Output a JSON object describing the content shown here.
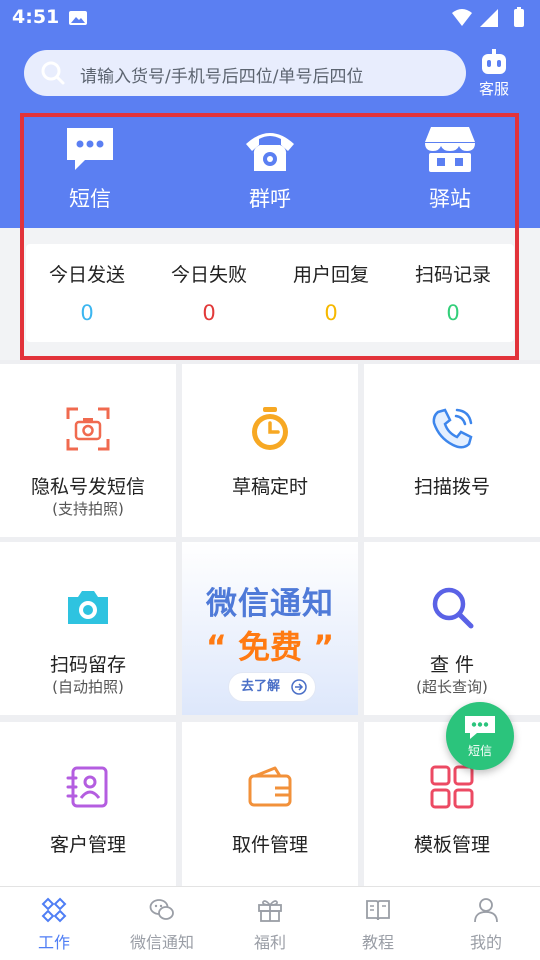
{
  "status_bar": {
    "time": "4:51"
  },
  "search": {
    "placeholder": "请输入货号/手机号后四位/单号后四位"
  },
  "customer_service": {
    "label": "客服"
  },
  "quick_actions": [
    {
      "label": "短信",
      "icon": "message-icon"
    },
    {
      "label": "群呼",
      "icon": "phone-icon"
    },
    {
      "label": "驿站",
      "icon": "store-icon"
    }
  ],
  "stats": [
    {
      "label": "今日发送",
      "value": "0",
      "color": "#3cb6f0"
    },
    {
      "label": "今日失败",
      "value": "0",
      "color": "#e23a3a"
    },
    {
      "label": "用户回复",
      "value": "0",
      "color": "#f6b800"
    },
    {
      "label": "扫码记录",
      "value": "0",
      "color": "#33cf7a"
    }
  ],
  "grid": {
    "private_sms": {
      "label": "隐私号发短信",
      "sub": "(支持拍照)"
    },
    "draft_timer": {
      "label": "草稿定时"
    },
    "scan_dial": {
      "label": "扫描拨号"
    },
    "scan_store": {
      "label": "扫码留存",
      "sub": "(自动拍照)"
    },
    "promo": {
      "title": "微信通知",
      "free": "“ 免费 ”",
      "button": "去了解"
    },
    "query": {
      "label": "查 件",
      "sub": "(超长查询)"
    },
    "customer_mgmt": {
      "label": "客户管理"
    },
    "pickup_mgmt": {
      "label": "取件管理"
    },
    "template_mgmt": {
      "label": "模板管理"
    }
  },
  "fab": {
    "label": "短信"
  },
  "tabs": [
    {
      "label": "工作",
      "active": true
    },
    {
      "label": "微信通知",
      "active": false
    },
    {
      "label": "福利",
      "active": false
    },
    {
      "label": "教程",
      "active": false
    },
    {
      "label": "我的",
      "active": false
    }
  ],
  "colors": {
    "primary": "#5b7ff2",
    "highlight": "#e2333a",
    "fab": "#2bc47c",
    "promo_orange": "#ff7a12"
  }
}
